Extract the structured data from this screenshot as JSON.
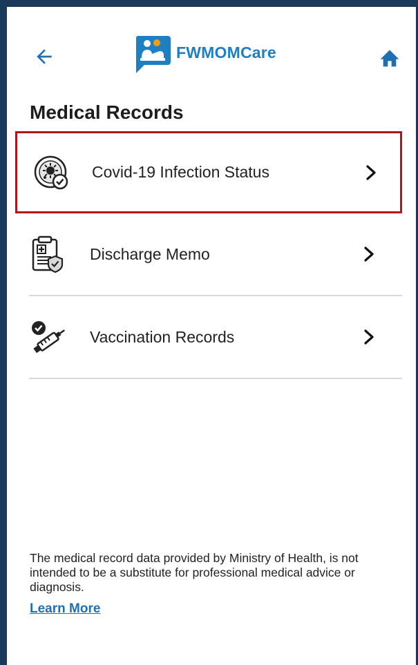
{
  "header": {
    "app_name": "FWMOMCare",
    "back_icon": "arrow-left-icon",
    "home_icon": "home-icon",
    "logo_icon": "fwmomcare-logo-icon"
  },
  "page": {
    "title": "Medical Records"
  },
  "records": [
    {
      "label": "Covid-19 Infection Status",
      "icon": "virus-shield-icon",
      "selected": true
    },
    {
      "label": "Discharge Memo",
      "icon": "clipboard-medical-icon",
      "selected": false
    },
    {
      "label": "Vaccination Records",
      "icon": "syringe-check-icon",
      "selected": false
    }
  ],
  "footer": {
    "disclaimer": "The medical record data provided by Ministry of Health, is not intended to be a substitute for professional medical advice or diagnosis.",
    "learn_more": "Learn More"
  },
  "colors": {
    "brand_blue": "#1f7fc3",
    "frame": "#1b3a5b",
    "selection_border": "#b3141c"
  }
}
